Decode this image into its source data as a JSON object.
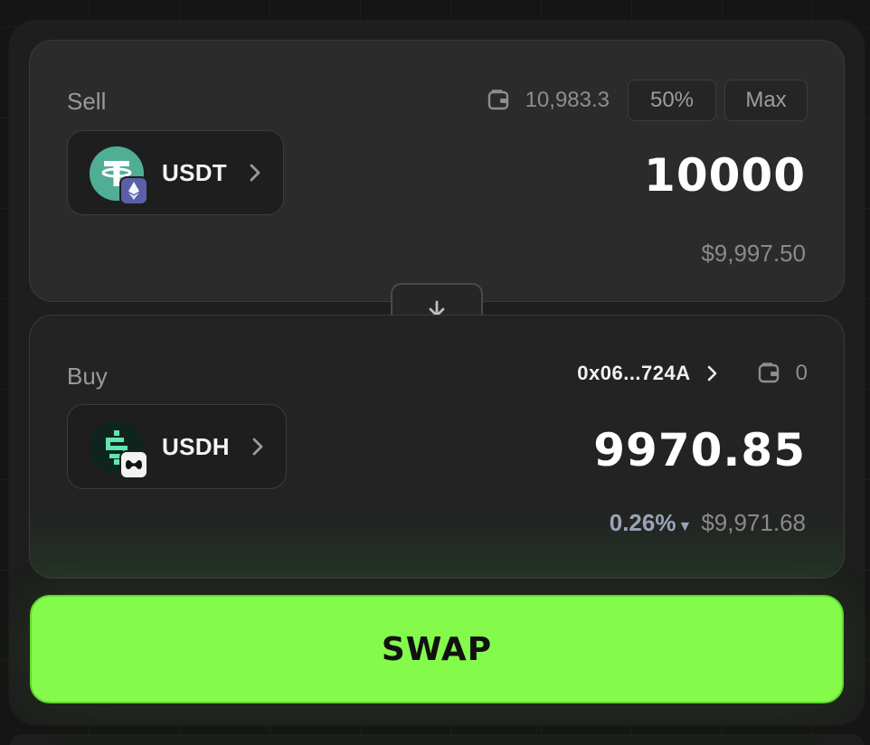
{
  "sell": {
    "label": "Sell",
    "balance": "10,983.3",
    "half_label": "50%",
    "max_label": "Max",
    "token": "USDT",
    "token_icon": "usdt-logo",
    "chain_icon": "ethereum-icon",
    "amount": "10000",
    "usd_value": "$9,997.50"
  },
  "buy": {
    "label": "Buy",
    "recipient": "0x06...724A",
    "balance": "0",
    "token": "USDH",
    "token_icon": "usdh-logo",
    "chain_icon": "hyperliquid-icon",
    "amount": "9970.85",
    "price_impact": "0.26%",
    "impact_arrow": "▼",
    "usd_value": "$9,971.68"
  },
  "swap_direction_icon": "arrow-down-icon",
  "swap_button": {
    "label": "SWAP"
  },
  "colors": {
    "accent": "#84fb4b",
    "usdt": "#50ae94",
    "usdh": "#10241f",
    "impact": "#9aa3b8"
  }
}
